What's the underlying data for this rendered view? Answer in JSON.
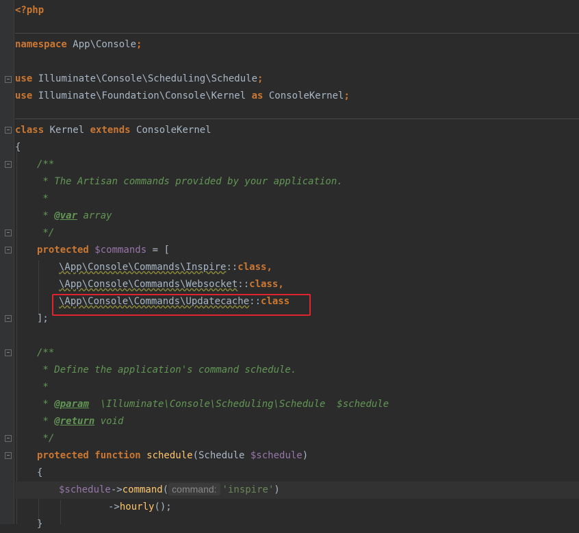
{
  "editor": {
    "lines": {
      "php_open": "<?php",
      "namespace_kw": "namespace",
      "namespace_name": " App\\Console",
      "semi": ";",
      "use_kw": "use",
      "use1_name": " Illuminate\\Console\\Scheduling\\Schedule",
      "use2_name": " Illuminate\\Foundation\\Console\\Kernel ",
      "as_kw": "as",
      "use2_alias": " ConsoleKernel",
      "class_kw": "class",
      "class_name": " Kernel ",
      "extends_kw": "extends",
      "parent_name": " ConsoleKernel",
      "brace_open": "{",
      "doc_open": "/**",
      "doc1_text": " * The Artisan commands provided by your application.",
      "doc_star": " *",
      "doc_var_prefix": " * ",
      "doc_var_tag": "@var",
      "doc_var_type": " array",
      "doc_close": " */",
      "protected_kw": "protected",
      "commands_var": " $commands",
      "assign_open": " = [",
      "cmd1_ns": "\\App\\Console\\Commands\\Inspire",
      "cmd2_ns": "\\App\\Console\\Commands\\Websocket",
      "cmd3_ns": "\\App\\Console\\Commands\\Updatecache",
      "double_colon": "::",
      "class_suffix_kw": "class",
      "comma": ",",
      "array_close": "];",
      "doc2_text": " * Define the application's command schedule.",
      "doc_param_tag": "@param",
      "doc_param_text": "  \\Illuminate\\Console\\Scheduling\\Schedule  $schedule",
      "doc_return_tag": "@return",
      "doc_return_text": " void",
      "function_kw": " function",
      "schedule_fn": " schedule",
      "param_open": "(Schedule ",
      "schedule_param": "$schedule",
      "param_close": ")",
      "schedule_var": "$schedule",
      "arrow": "->",
      "command_fn": "command",
      "paren_open": "(",
      "param_hint": "command:",
      "inspire_str": "'inspire'",
      "paren_close": ")",
      "hourly_fn": "hourly",
      "call_end": "();",
      "brace_close": "}"
    }
  },
  "colors": {
    "background": "#2b2b2b",
    "keyword": "#cc7832",
    "variable": "#9876aa",
    "function": "#ffc66d",
    "doc_comment": "#629755",
    "highlight_box": "#e0232f"
  }
}
